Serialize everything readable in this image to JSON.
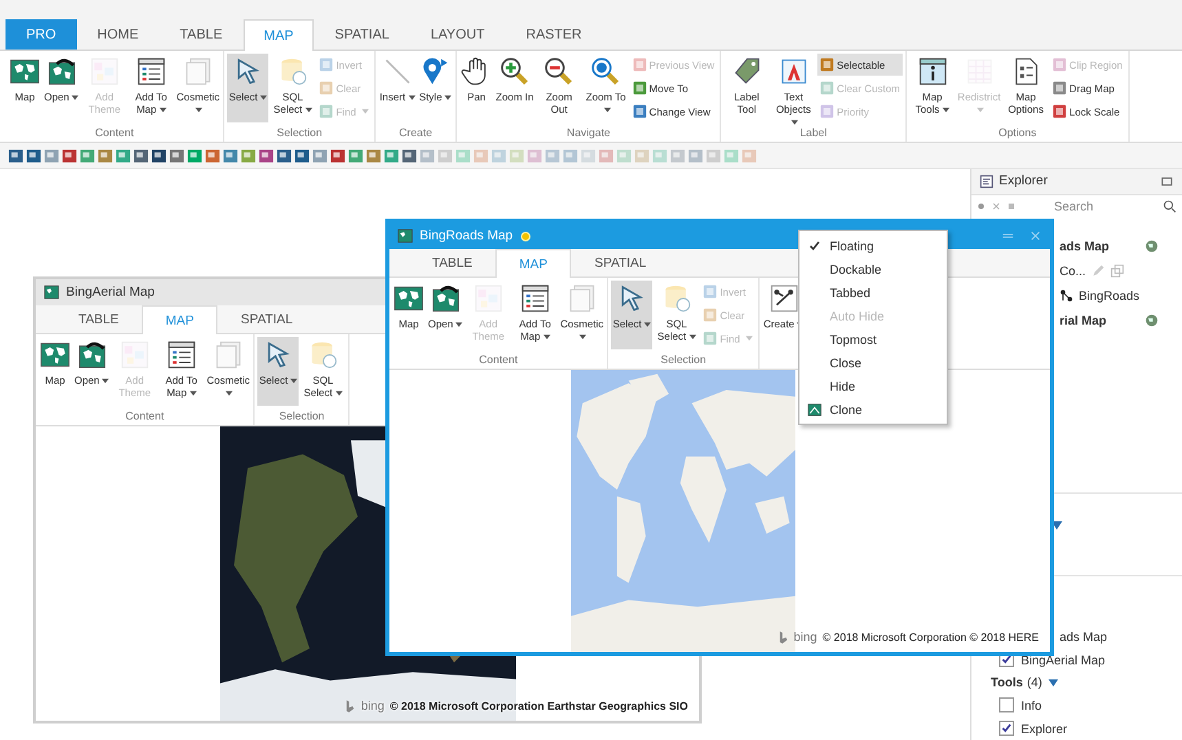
{
  "tabs": [
    {
      "label": "PRO",
      "kind": "backstage",
      "selected": false
    },
    {
      "label": "HOME",
      "kind": "tab",
      "selected": false
    },
    {
      "label": "TABLE",
      "kind": "tab",
      "selected": false
    },
    {
      "label": "MAP",
      "kind": "tab",
      "selected": true
    },
    {
      "label": "SPATIAL",
      "kind": "tab",
      "selected": false
    },
    {
      "label": "LAYOUT",
      "kind": "tab",
      "selected": false
    },
    {
      "label": "RASTER",
      "kind": "tab",
      "selected": false
    }
  ],
  "ribbon": {
    "groups": [
      {
        "label": "Content",
        "large": [
          {
            "label": "Map",
            "dropdown": false,
            "disabled": false,
            "active": false
          },
          {
            "label": "Open",
            "dropdown": true,
            "disabled": false,
            "active": false
          },
          {
            "label": "Add Theme",
            "dropdown": false,
            "disabled": true,
            "active": false
          },
          {
            "label": "Add To Map",
            "dropdown": true,
            "disabled": false,
            "active": false
          },
          {
            "label": "Cosmetic",
            "dropdown": true,
            "disabled": false,
            "active": false
          }
        ]
      },
      {
        "label": "Selection",
        "large": [
          {
            "label": "Select",
            "dropdown": true,
            "disabled": false,
            "active": true
          },
          {
            "label": "SQL Select",
            "dropdown": true,
            "disabled": false,
            "active": false
          }
        ],
        "small": [
          {
            "label": "Invert",
            "dropdown": false,
            "disabled": true,
            "active": false
          },
          {
            "label": "Clear",
            "dropdown": false,
            "disabled": true,
            "active": false
          },
          {
            "label": "Find",
            "dropdown": true,
            "disabled": true,
            "active": false
          }
        ]
      },
      {
        "label": "Create",
        "large": [
          {
            "label": "Insert",
            "dropdown": true,
            "disabled": false,
            "active": false
          },
          {
            "label": "Style",
            "dropdown": true,
            "disabled": false,
            "active": false
          }
        ]
      },
      {
        "label": "Navigate",
        "large": [
          {
            "label": "Pan",
            "dropdown": false,
            "disabled": false,
            "active": false
          },
          {
            "label": "Zoom In",
            "dropdown": false,
            "disabled": false,
            "active": false
          },
          {
            "label": "Zoom Out",
            "dropdown": false,
            "disabled": false,
            "active": false
          },
          {
            "label": "Zoom To",
            "dropdown": true,
            "disabled": false,
            "active": false
          }
        ],
        "small": [
          {
            "label": "Previous View",
            "dropdown": false,
            "disabled": true,
            "active": false
          },
          {
            "label": "Move To",
            "dropdown": false,
            "disabled": false,
            "active": false
          },
          {
            "label": "Change View",
            "dropdown": false,
            "disabled": false,
            "active": false
          }
        ]
      },
      {
        "label": "Label",
        "large": [
          {
            "label": "Label Tool",
            "dropdown": false,
            "disabled": false,
            "active": false
          },
          {
            "label": "Text Objects",
            "dropdown": true,
            "disabled": false,
            "active": false
          }
        ],
        "small": [
          {
            "label": "Selectable",
            "dropdown": false,
            "disabled": false,
            "active": true
          },
          {
            "label": "Clear Custom",
            "dropdown": false,
            "disabled": true,
            "active": false
          },
          {
            "label": "Priority",
            "dropdown": false,
            "disabled": true,
            "active": false
          }
        ]
      },
      {
        "label": "Options",
        "large": [
          {
            "label": "Map Tools",
            "dropdown": true,
            "disabled": false,
            "active": false
          },
          {
            "label": "Redistrict",
            "dropdown": true,
            "disabled": true,
            "active": false
          },
          {
            "label": "Map Options",
            "dropdown": false,
            "disabled": false,
            "active": false
          }
        ],
        "small": [
          {
            "label": "Clip Region",
            "dropdown": false,
            "disabled": true,
            "active": false
          },
          {
            "label": "Drag Map",
            "dropdown": false,
            "disabled": false,
            "active": false
          },
          {
            "label": "Lock Scale",
            "dropdown": false,
            "disabled": false,
            "active": false
          }
        ]
      }
    ]
  },
  "windows": [
    {
      "title": "BingAerial Map",
      "active": false,
      "pinned": false,
      "tabs": [
        {
          "label": "TABLE",
          "selected": false
        },
        {
          "label": "MAP",
          "selected": true
        },
        {
          "label": "SPATIAL",
          "selected": false
        }
      ],
      "groups": [
        {
          "label": "Content",
          "large": [
            {
              "label": "Map",
              "dropdown": false,
              "disabled": false,
              "active": false
            },
            {
              "label": "Open",
              "dropdown": true,
              "disabled": false,
              "active": false
            },
            {
              "label": "Add Theme",
              "dropdown": false,
              "disabled": true,
              "active": false
            },
            {
              "label": "Add To Map",
              "dropdown": true,
              "disabled": false,
              "active": false
            },
            {
              "label": "Cosmetic",
              "dropdown": true,
              "disabled": false,
              "active": false
            }
          ]
        },
        {
          "label": "Selection",
          "large": [
            {
              "label": "Select",
              "dropdown": true,
              "disabled": false,
              "active": true
            },
            {
              "label": "SQL Select",
              "dropdown": true,
              "disabled": false,
              "active": false
            }
          ]
        }
      ],
      "map": {
        "kind": "aerial",
        "logo": "bing",
        "attribution": "© 2018 Microsoft Corporation Earthstar Geographics SIO"
      }
    },
    {
      "title": "BingRoads Map",
      "active": true,
      "pinned": true,
      "tabs": [
        {
          "label": "TABLE",
          "selected": false
        },
        {
          "label": "MAP",
          "selected": true
        },
        {
          "label": "SPATIAL",
          "selected": false
        }
      ],
      "groups": [
        {
          "label": "Content",
          "large": [
            {
              "label": "Map",
              "dropdown": false,
              "disabled": false,
              "active": false
            },
            {
              "label": "Open",
              "dropdown": true,
              "disabled": false,
              "active": false
            },
            {
              "label": "Add Theme",
              "dropdown": false,
              "disabled": true,
              "active": false
            },
            {
              "label": "Add To Map",
              "dropdown": true,
              "disabled": false,
              "active": false
            },
            {
              "label": "Cosmetic",
              "dropdown": true,
              "disabled": false,
              "active": false
            }
          ]
        },
        {
          "label": "Selection",
          "large": [
            {
              "label": "Select",
              "dropdown": true,
              "disabled": false,
              "active": true
            },
            {
              "label": "SQL Select",
              "dropdown": true,
              "disabled": false,
              "active": false
            }
          ],
          "small": [
            {
              "label": "Invert",
              "dropdown": false,
              "disabled": true,
              "active": false
            },
            {
              "label": "Clear",
              "dropdown": false,
              "disabled": true,
              "active": false
            },
            {
              "label": "Find",
              "dropdown": true,
              "disabled": true,
              "active": false
            }
          ]
        },
        {
          "large": [
            {
              "label": "Create",
              "dropdown": true,
              "disabled": false,
              "active": false
            }
          ]
        }
      ],
      "map": {
        "kind": "road",
        "logo": "bing",
        "attribution": "© 2018 Microsoft Corporation © 2018 HERE"
      }
    }
  ],
  "context_menu": {
    "items": [
      {
        "label": "Floating",
        "kind": "text",
        "checked": true,
        "disabled": false
      },
      {
        "label": "Dockable",
        "kind": "text",
        "checked": false,
        "disabled": false
      },
      {
        "label": "Tabbed",
        "kind": "text",
        "checked": false,
        "disabled": false
      },
      {
        "label": "Auto Hide",
        "kind": "text",
        "checked": false,
        "disabled": true
      },
      {
        "label": "Topmost",
        "kind": "text",
        "checked": false,
        "disabled": false
      },
      {
        "label": "Close",
        "kind": "text",
        "checked": false,
        "disabled": false
      },
      {
        "label": "Hide",
        "kind": "text",
        "checked": false,
        "disabled": false
      },
      {
        "label": "Clone",
        "kind": "icon",
        "checked": false,
        "disabled": false
      }
    ]
  },
  "explorer": {
    "title": "Explorer",
    "search": {
      "placeholder": "Search"
    },
    "tree": [
      {
        "label": "ads Map",
        "kind": "map",
        "children": [
          {
            "label": "Co...",
            "kind": "group",
            "children": [
              {
                "label": "BingRoads",
                "kind": "layer"
              }
            ]
          }
        ]
      },
      {
        "label": "rial Map",
        "kind": "map"
      }
    ],
    "partial_item": "ads Map",
    "layers": [
      {
        "label": "BingAerial Map",
        "checked": true
      }
    ],
    "tools": {
      "label": "Tools",
      "count": "(4)",
      "expanded": true,
      "items": [
        {
          "label": "Info",
          "checked": false
        },
        {
          "label": "Explorer",
          "checked": true
        }
      ]
    }
  }
}
